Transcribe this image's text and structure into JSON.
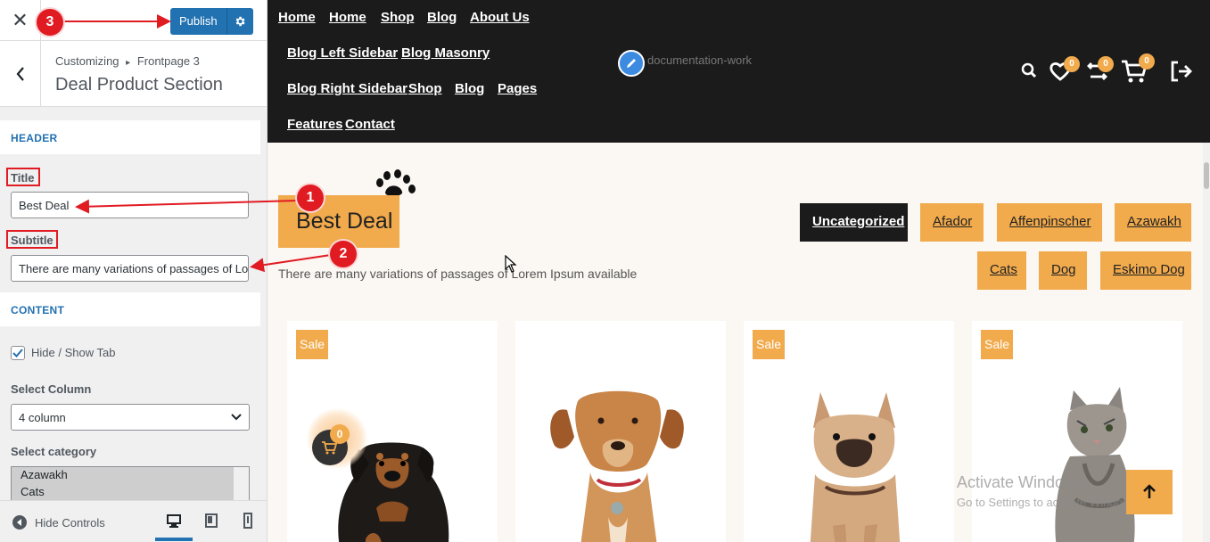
{
  "customizer": {
    "close_label": "✕",
    "publish_label": "Publish",
    "breadcrumb_root": "Customizing",
    "breadcrumb_sep": "▸",
    "breadcrumb_page": "Frontpage 3",
    "section_title": "Deal Product Section",
    "header_section": "HEADER",
    "title_label": "Title",
    "title_value": "Best Deal",
    "subtitle_label": "Subtitle",
    "subtitle_value": "There are many variations of passages of Lorem Ipsum available",
    "content_section": "CONTENT",
    "hide_show_tab": "Hide / Show Tab",
    "hide_show_checked": true,
    "select_column_label": "Select Column",
    "select_column_value": "4 column",
    "select_category_label": "Select category",
    "category_options": [
      "Azawakh",
      "Cats"
    ],
    "hide_controls": "Hide Controls"
  },
  "site": {
    "nav_row1": [
      "Home",
      "Home",
      "Shop",
      "Blog",
      "About Us"
    ],
    "nav_row2": [
      "Blog Left Sidebar",
      "Blog Masonry"
    ],
    "nav_row3": [
      "Blog Right Sidebar",
      "Shop",
      "Blog",
      "Pages"
    ],
    "nav_row4": [
      "Features",
      "Contact"
    ],
    "logo_alt": "documentation-work",
    "wishlist_count": "0",
    "compare_count": "0",
    "cart_count": "0",
    "deal_title": "Best Deal",
    "deal_subtitle": "There are many variations of passages of Lorem Ipsum available",
    "categories_row1": [
      "Uncategorized",
      "Afador",
      "Affenpinscher",
      "Azawakh"
    ],
    "categories_row2": [
      "Cats",
      "Dog",
      "Eskimo Dog"
    ],
    "sale_label": "Sale",
    "floating_cart_count": "0"
  },
  "annotations": [
    "1",
    "2",
    "3"
  ],
  "watermark": {
    "line1": "Activate Windows",
    "line2": "Go to Settings to activate Windows."
  },
  "colors": {
    "accent": "#f1aa4c",
    "topbar": "#1b1b1b",
    "wp_blue": "#2271b1",
    "annotation_red": "#e11b22"
  }
}
